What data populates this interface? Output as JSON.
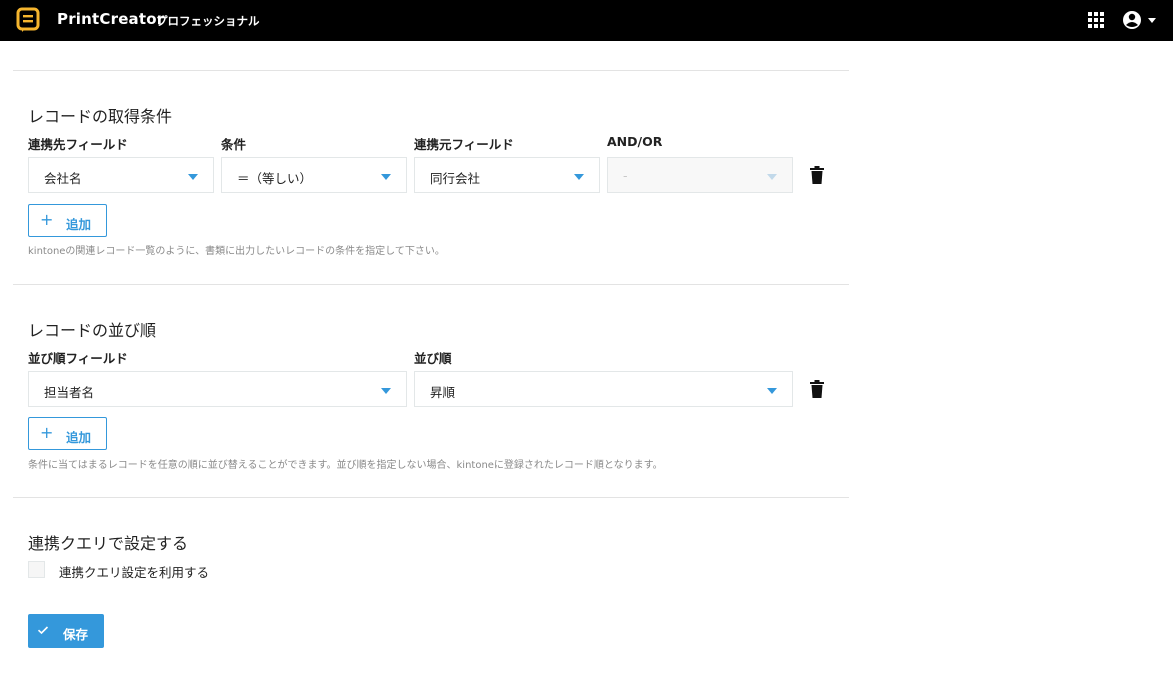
{
  "header": {
    "app_name": "PrintCreator",
    "edition": "プロフェッショナル",
    "icons": {
      "logo": "printcreator-logo",
      "apps": "grid-icon",
      "account": "account-icon"
    }
  },
  "colors": {
    "accent": "#3498db",
    "header_bg": "#000000",
    "logo": "#f5b52e"
  },
  "fetch_conditions": {
    "title": "レコードの取得条件",
    "labels": {
      "dest_field": "連携先フィールド",
      "condition": "条件",
      "src_field": "連携元フィールド",
      "and_or": "AND/OR"
    },
    "row": {
      "dest_field": "会社名",
      "condition": "＝（等しい）",
      "src_field": "同行会社",
      "and_or": "-"
    },
    "add_label": "追加",
    "help": "kintoneの関連レコード一覧のように、書類に出力したいレコードの条件を指定して下さい。"
  },
  "sort_order": {
    "title": "レコードの並び順",
    "labels": {
      "field": "並び順フィールド",
      "order": "並び順"
    },
    "row": {
      "field": "担当者名",
      "order": "昇順"
    },
    "add_label": "追加",
    "help": "条件に当てはまるレコードを任意の順に並び替えることができます。並び順を指定しない場合、kintoneに登録されたレコード順となります。"
  },
  "query": {
    "title": "連携クエリで設定する",
    "checkbox_label": "連携クエリ設定を利用する",
    "checked": false
  },
  "save_label": "保存"
}
